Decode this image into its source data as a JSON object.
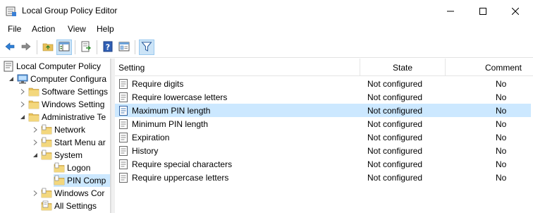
{
  "window": {
    "title": "Local Group Policy Editor"
  },
  "menu": [
    "File",
    "Action",
    "View",
    "Help"
  ],
  "toolbar": {
    "icons": [
      "back-arrow-icon",
      "forward-arrow-icon",
      "folder-up-icon",
      "show-hide-tree-icon",
      "export-list-icon",
      "help-icon",
      "properties-icon",
      "filter-icon"
    ]
  },
  "tree": {
    "items": [
      {
        "label": "Local Computer Policy",
        "icon": "computer-policy-icon"
      },
      {
        "label": "Computer Configura",
        "icon": "computer-icon"
      },
      {
        "label": "Software Settings",
        "icon": "folder-icon"
      },
      {
        "label": "Windows Setting",
        "icon": "folder-icon"
      },
      {
        "label": "Administrative Te",
        "icon": "folder-icon"
      },
      {
        "label": "Network",
        "icon": "folder-icon"
      },
      {
        "label": "Start Menu ar",
        "icon": "folder-icon"
      },
      {
        "label": "System",
        "icon": "folder-icon"
      },
      {
        "label": "Logon",
        "icon": "folder-icon"
      },
      {
        "label": "PIN Comp",
        "icon": "folder-icon"
      },
      {
        "label": "Windows Cor",
        "icon": "folder-icon"
      },
      {
        "label": "All Settings",
        "icon": "all-settings-icon"
      }
    ],
    "selected": "PIN Comp"
  },
  "list": {
    "columns": {
      "setting": "Setting",
      "state": "State",
      "comment": "Comment"
    },
    "rows": [
      {
        "setting": "Require digits",
        "state": "Not configured",
        "comment": "No"
      },
      {
        "setting": "Require lowercase letters",
        "state": "Not configured",
        "comment": "No"
      },
      {
        "setting": "Maximum PIN length",
        "state": "Not configured",
        "comment": "No"
      },
      {
        "setting": "Minimum PIN length",
        "state": "Not configured",
        "comment": "No"
      },
      {
        "setting": "Expiration",
        "state": "Not configured",
        "comment": "No"
      },
      {
        "setting": "History",
        "state": "Not configured",
        "comment": "No"
      },
      {
        "setting": "Require special characters",
        "state": "Not configured",
        "comment": "No"
      },
      {
        "setting": "Require uppercase letters",
        "state": "Not configured",
        "comment": "No"
      }
    ],
    "selected": "Maximum PIN length"
  },
  "colors": {
    "selection": "#cce8ff",
    "folder": "#e8c15a",
    "accent": "#1e6fc8"
  }
}
